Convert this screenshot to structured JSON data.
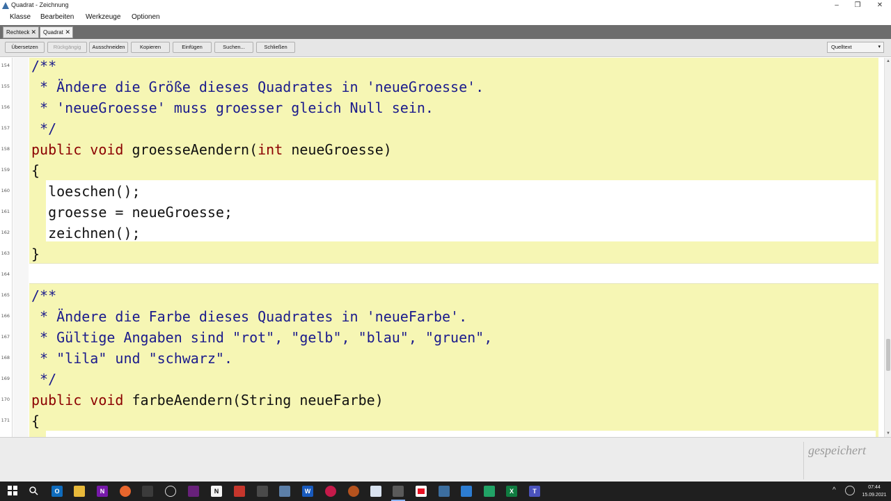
{
  "window": {
    "title": "Quadrat - Zeichnung"
  },
  "window_controls": {
    "minimize": "–",
    "maximize": "❐",
    "close": "✕"
  },
  "menu": [
    "Klasse",
    "Bearbeiten",
    "Werkzeuge",
    "Optionen"
  ],
  "tabs": [
    {
      "label": "Rechteck",
      "close": "✕"
    },
    {
      "label": "Quadrat",
      "close": "✕"
    }
  ],
  "toolbar": {
    "buttons": [
      "Übersetzen",
      "Rückgängig",
      "Ausschneiden",
      "Kopieren",
      "Einfügen",
      "Suchen...",
      "Schließen"
    ],
    "disabled": [
      "Rückgängig"
    ],
    "view_selector": "Quelltext",
    "view_caret": "▾"
  },
  "editor": {
    "line_numbers": [
      "154",
      "155",
      "156",
      "157",
      "158",
      "159",
      "160",
      "161",
      "162",
      "163",
      "164",
      "165",
      "166",
      "167",
      "168",
      "169",
      "170",
      "171"
    ],
    "code_lines": [
      "/**",
      " * Ändere die Größe dieses Quadrates in 'neueGroesse'.",
      " * 'neueGroesse' muss groesser gleich Null sein.",
      " */",
      "public void groesseAendern(int neueGroesse)",
      "{",
      "  loeschen();",
      "  groesse = neueGroesse;",
      "  zeichnen();",
      "}",
      "",
      "/**",
      " * Ändere die Farbe dieses Quadrates in 'neueFarbe'.",
      " * Gültige Angaben sind \"rot\", \"gelb\", \"blau\", \"gruen\",",
      " * \"lila\" und \"schwarz\".",
      " */",
      "public void farbeAendern(String neueFarbe)",
      "{"
    ],
    "code_tokens": {
      "line_158": {
        "kw1": "public",
        "kw2": "void",
        "name": "groesseAendern(",
        "kw3": "int",
        "rest": "neueGroesse)"
      },
      "line_170": {
        "kw1": "public",
        "kw2": "void",
        "name": "farbeAendern(String neueFarbe)"
      }
    }
  },
  "status": {
    "text": "gespeichert"
  },
  "taskbar": {
    "clock_time": "07:44",
    "clock_date": "15.09.2021",
    "tray_chevron": "^"
  },
  "colors": {
    "keyword": "#8b0000",
    "comment": "#1b1b8c",
    "code_background": "#f6f6b4",
    "tab_bar": "#6d6d6d"
  }
}
